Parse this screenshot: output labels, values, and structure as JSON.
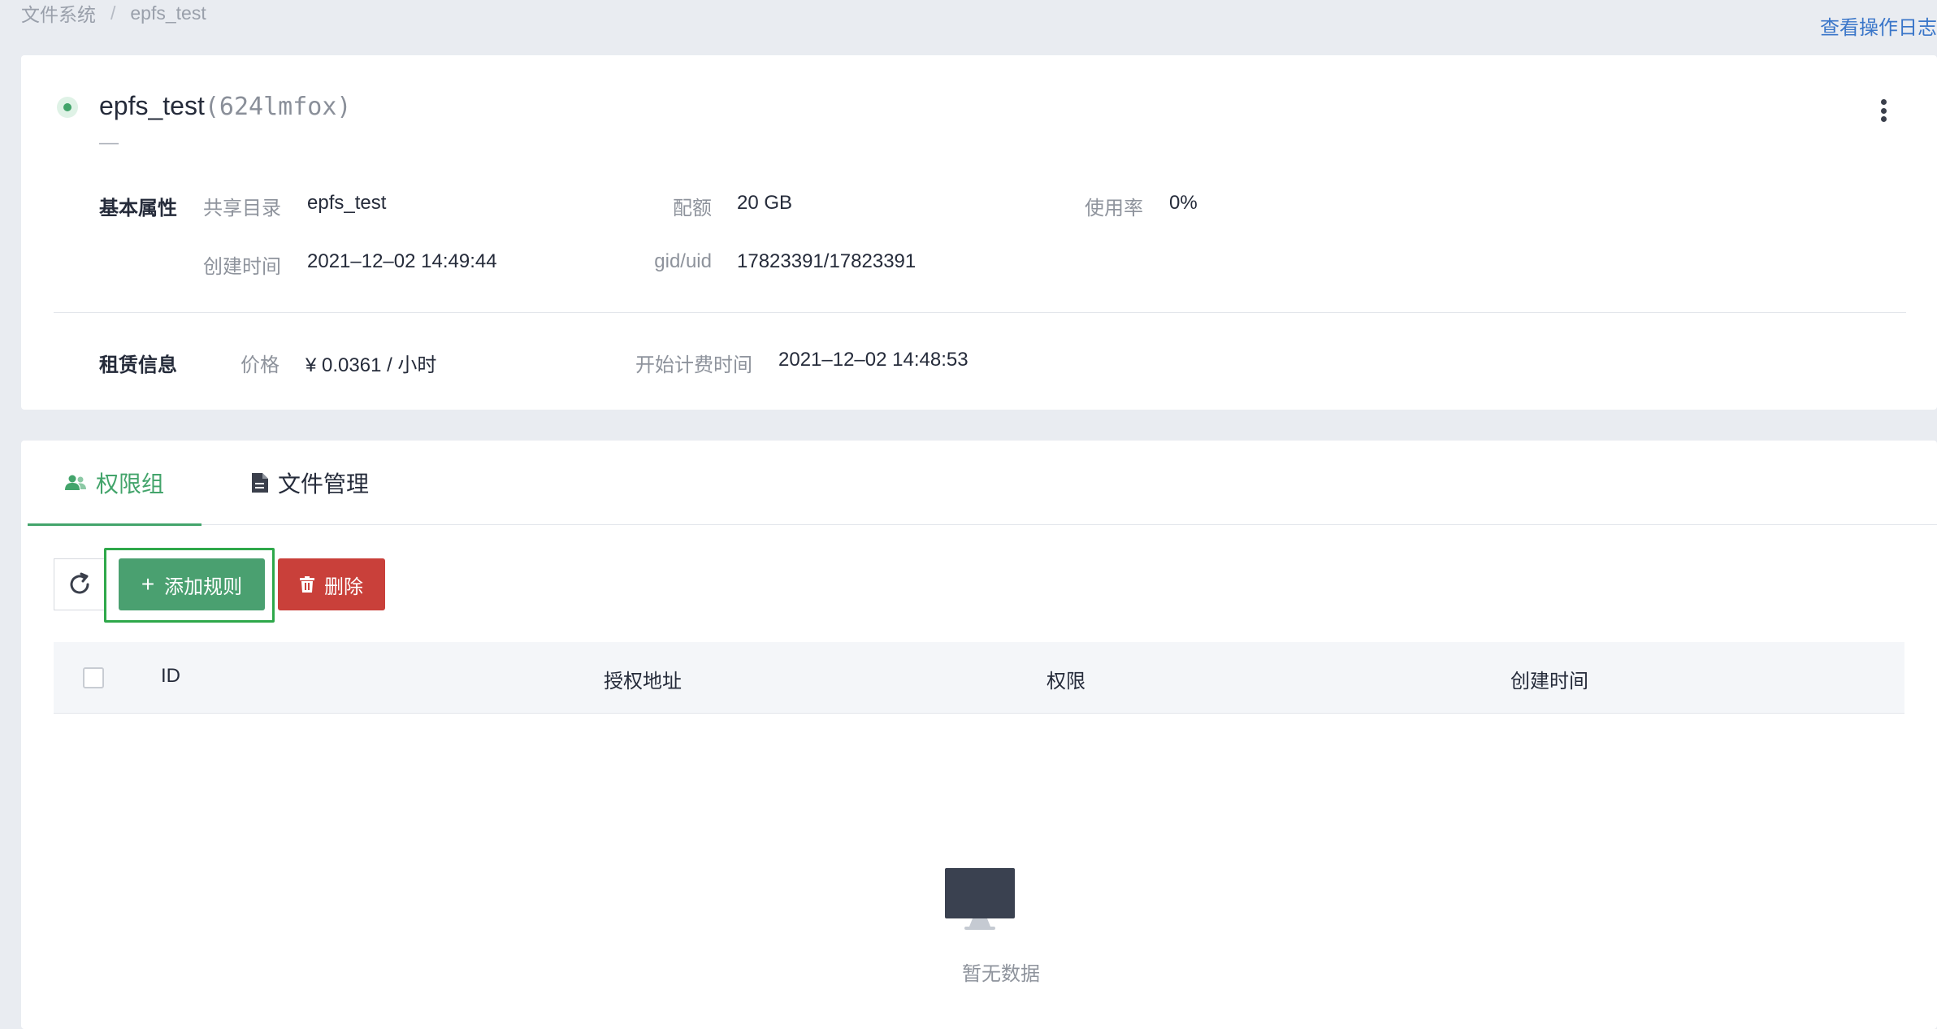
{
  "breadcrumb": {
    "root": "文件系统",
    "separator": "/",
    "current": "epfs_test"
  },
  "header": {
    "oplog_link": "查看操作日志"
  },
  "instance": {
    "name": "epfs_test",
    "id": "(624lmfox)",
    "description": "—",
    "status_color": "#43a46b",
    "basic": {
      "section_label": "基本属性",
      "share_dir_label": "共享目录",
      "share_dir_value": "epfs_test",
      "quota_label": "配额",
      "quota_value": "20 GB",
      "usage_label": "使用率",
      "usage_value": "0%",
      "created_label": "创建时间",
      "created_value": "2021–12–02 14:49:44",
      "gid_label": "gid/uid",
      "gid_value": "17823391/17823391"
    },
    "lease": {
      "section_label": "租赁信息",
      "price_label": "价格",
      "price_value": "¥ 0.0361 / 小时",
      "billing_start_label": "开始计费时间",
      "billing_start_value": "2021–12–02 14:48:53"
    }
  },
  "tabs": [
    {
      "label": "权限组",
      "icon": "users-icon",
      "active": true
    },
    {
      "label": "文件管理",
      "icon": "file-icon",
      "active": false
    }
  ],
  "toolbar": {
    "refresh_icon": "refresh-icon",
    "add_label": "添加规则",
    "delete_label": "删除"
  },
  "table": {
    "columns": [
      "ID",
      "授权地址",
      "权限",
      "创建时间"
    ],
    "rows": [],
    "empty_text": "暂无数据"
  },
  "colors": {
    "accent_green": "#43a46b",
    "danger_red": "#c9403a",
    "link_blue": "#3a76c9"
  }
}
